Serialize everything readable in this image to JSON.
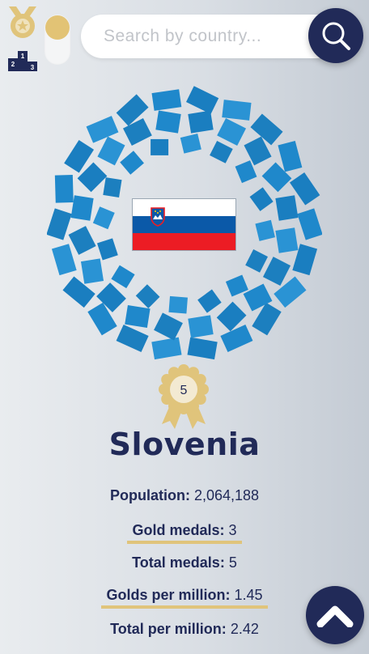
{
  "search": {
    "placeholder": "Search by country..."
  },
  "toggle": {
    "state": "on"
  },
  "country": {
    "name": "Slovenia",
    "rank": "5",
    "flag_colors": {
      "top": "#ffffff",
      "middle": "#0b59a8",
      "bottom": "#ec1c24"
    }
  },
  "stats": [
    {
      "label": "Population:",
      "value": "2,064,188",
      "highlighted": false
    },
    {
      "label": "Gold medals:",
      "value": "3",
      "highlighted": true
    },
    {
      "label": "Total medals:",
      "value": "5",
      "highlighted": false
    },
    {
      "label": "Golds per million:",
      "value": "1.45",
      "highlighted": true
    },
    {
      "label": "Total per million:",
      "value": "2.42",
      "highlighted": false
    }
  ],
  "podium_labels": {
    "first": "1",
    "second": "2",
    "third": "3"
  },
  "colors": {
    "navy": "#212a58",
    "gold": "#e0c47b",
    "emblem_blue": "#1f88cb"
  },
  "icons": {
    "medal": "medal-icon",
    "podium": "podium-icon",
    "search": "search-icon",
    "scroll_up": "chevron-up-icon"
  }
}
